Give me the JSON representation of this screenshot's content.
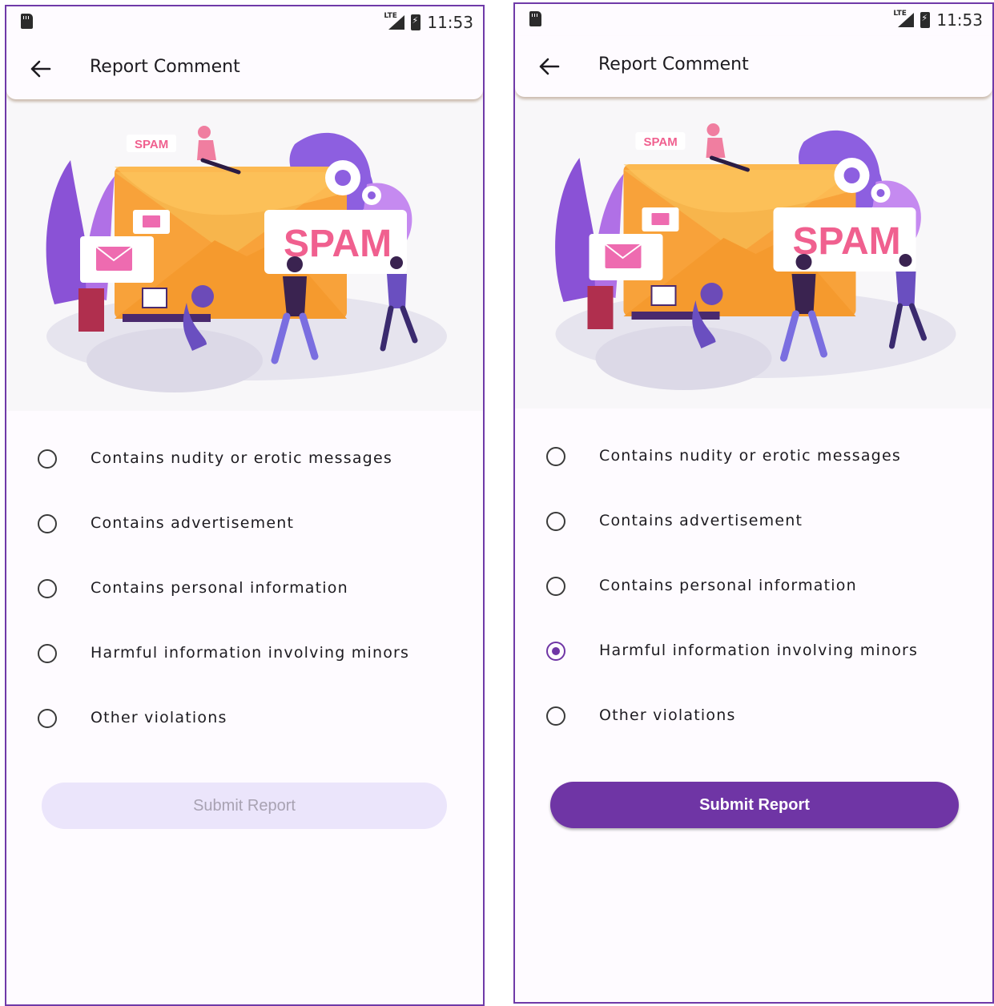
{
  "status_bar": {
    "network_label": "LTE",
    "time": "11:53"
  },
  "app_bar": {
    "title": "Report Comment"
  },
  "illustration": {
    "sign_text": "SPAM",
    "tag_text": "SPAM"
  },
  "options": [
    {
      "label": "Contains nudity or erotic messages"
    },
    {
      "label": "Contains advertisement"
    },
    {
      "label": "Contains personal information"
    },
    {
      "label": "Harmful information involving minors"
    },
    {
      "label": "Other violations"
    }
  ],
  "screens": {
    "left": {
      "selected_option": null,
      "submit_enabled": false
    },
    "right": {
      "selected_option": "Harmful information involving minors",
      "submit_enabled": true
    }
  },
  "submit_label": "Submit Report",
  "colors": {
    "accent": "#6f35a5",
    "frame": "#6f3aa8",
    "background": "#fefbff",
    "disabled_button": "#ebe5fb",
    "disabled_text": "#a8a2b2"
  }
}
